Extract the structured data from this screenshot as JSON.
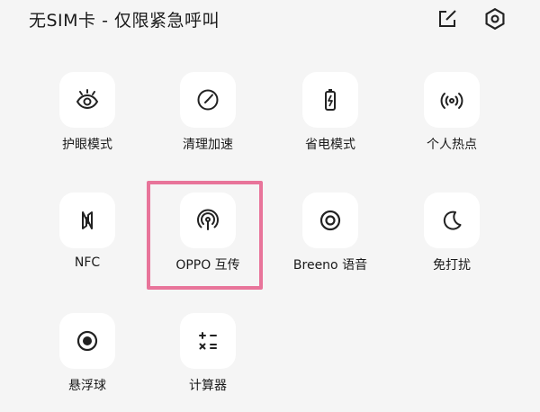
{
  "status": {
    "text": "无SIM卡 - 仅限紧急呼叫"
  },
  "header_icons": [
    {
      "name": "edit-icon"
    },
    {
      "name": "settings-icon"
    }
  ],
  "tiles": [
    {
      "label": "护眼模式",
      "icon": "eye-icon"
    },
    {
      "label": "清理加速",
      "icon": "speed-gauge-icon"
    },
    {
      "label": "省电模式",
      "icon": "battery-icon"
    },
    {
      "label": "个人热点",
      "icon": "hotspot-icon"
    },
    {
      "label": "NFC",
      "icon": "nfc-icon"
    },
    {
      "label": "OPPO 互传",
      "icon": "oppo-share-icon",
      "highlighted": true
    },
    {
      "label": "Breeno 语音",
      "icon": "breeno-icon"
    },
    {
      "label": "免打扰",
      "icon": "moon-icon"
    },
    {
      "label": "悬浮球",
      "icon": "floating-ball-icon"
    },
    {
      "label": "计算器",
      "icon": "calculator-icon"
    }
  ],
  "colors": {
    "highlight_border": "#e8749a",
    "background": "#f5f5f5",
    "tile_bg": "#ffffff"
  }
}
